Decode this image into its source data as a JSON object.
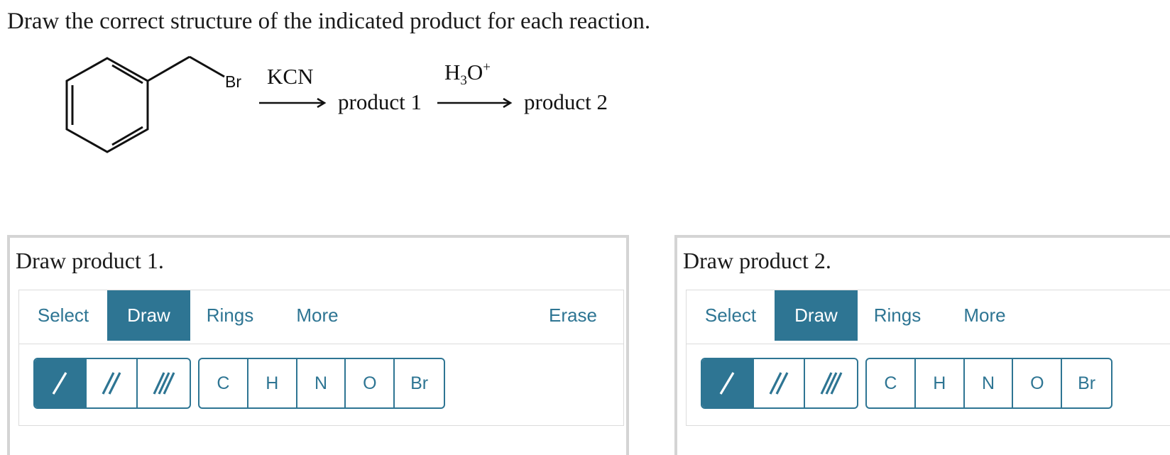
{
  "instruction": "Draw the correct structure of the indicated product for each reaction.",
  "scheme": {
    "substituent_atom": "Br",
    "reagent1": "KCN",
    "reagent2": {
      "base": "H",
      "sub": "3",
      "main": "O",
      "sup": "+"
    },
    "product1": "product 1",
    "product2": "product 2"
  },
  "panels": [
    {
      "title": "Draw product 1.",
      "tabs": [
        "Select",
        "Draw",
        "Rings",
        "More"
      ],
      "active_tab": "Draw",
      "erase_label": "Erase",
      "bond_tools": [
        "single-bond-icon",
        "double-bond-icon",
        "triple-bond-icon"
      ],
      "active_bond": "single-bond-icon",
      "atoms": [
        "C",
        "H",
        "N",
        "O",
        "Br"
      ]
    },
    {
      "title": "Draw product 2.",
      "tabs": [
        "Select",
        "Draw",
        "Rings",
        "More"
      ],
      "active_tab": "Draw",
      "bond_tools": [
        "single-bond-icon",
        "double-bond-icon",
        "triple-bond-icon"
      ],
      "active_bond": "single-bond-icon",
      "atoms": [
        "C",
        "H",
        "N",
        "O",
        "Br"
      ]
    }
  ],
  "colors": {
    "accent": "#2e7593",
    "panel_border": "#d4d4d4"
  }
}
